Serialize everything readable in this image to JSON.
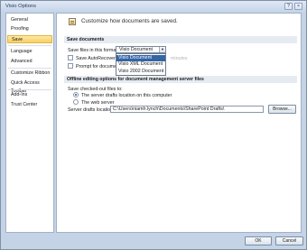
{
  "window": {
    "title": "Visio Options"
  },
  "title_buttons": {
    "help": "?",
    "close": "×"
  },
  "sidebar": {
    "items": [
      {
        "label": "General"
      },
      {
        "label": "Proofing"
      },
      {
        "label": "Save",
        "selected": true
      },
      {
        "label": "Language"
      },
      {
        "label": "Advanced"
      },
      {
        "label": "Customize Ribbon"
      },
      {
        "label": "Quick Access Toolbar"
      },
      {
        "label": "Add-Ins"
      },
      {
        "label": "Trust Center"
      }
    ]
  },
  "main": {
    "header_text": "Customize how documents are saved.",
    "save_section": {
      "title": "Save documents",
      "format_label": "Save files in this format:",
      "format_value": "Visio Document",
      "autorecover_label": "Save AutoRecover info",
      "minutes_label": "minutes",
      "prompt_label": "Prompt for document"
    },
    "dropdown": {
      "options": [
        "Visio Document",
        "Visio XML Document",
        "Visio 2002 Document"
      ],
      "selected_index": 0
    },
    "offline_section": {
      "title": "Offline editing options for document management server files",
      "checked_out_label": "Save checked-out files to:",
      "radio_drafts": "The server drafts location on this computer",
      "radio_web": "The web server",
      "drafts_location_label": "Server drafts location:",
      "drafts_location_value": "C:\\Users\\niamh.lynch\\Documents\\SharePoint Drafts\\",
      "browse_label": "Browse..."
    }
  },
  "footer": {
    "ok_label": "OK",
    "cancel_label": "Cancel"
  }
}
